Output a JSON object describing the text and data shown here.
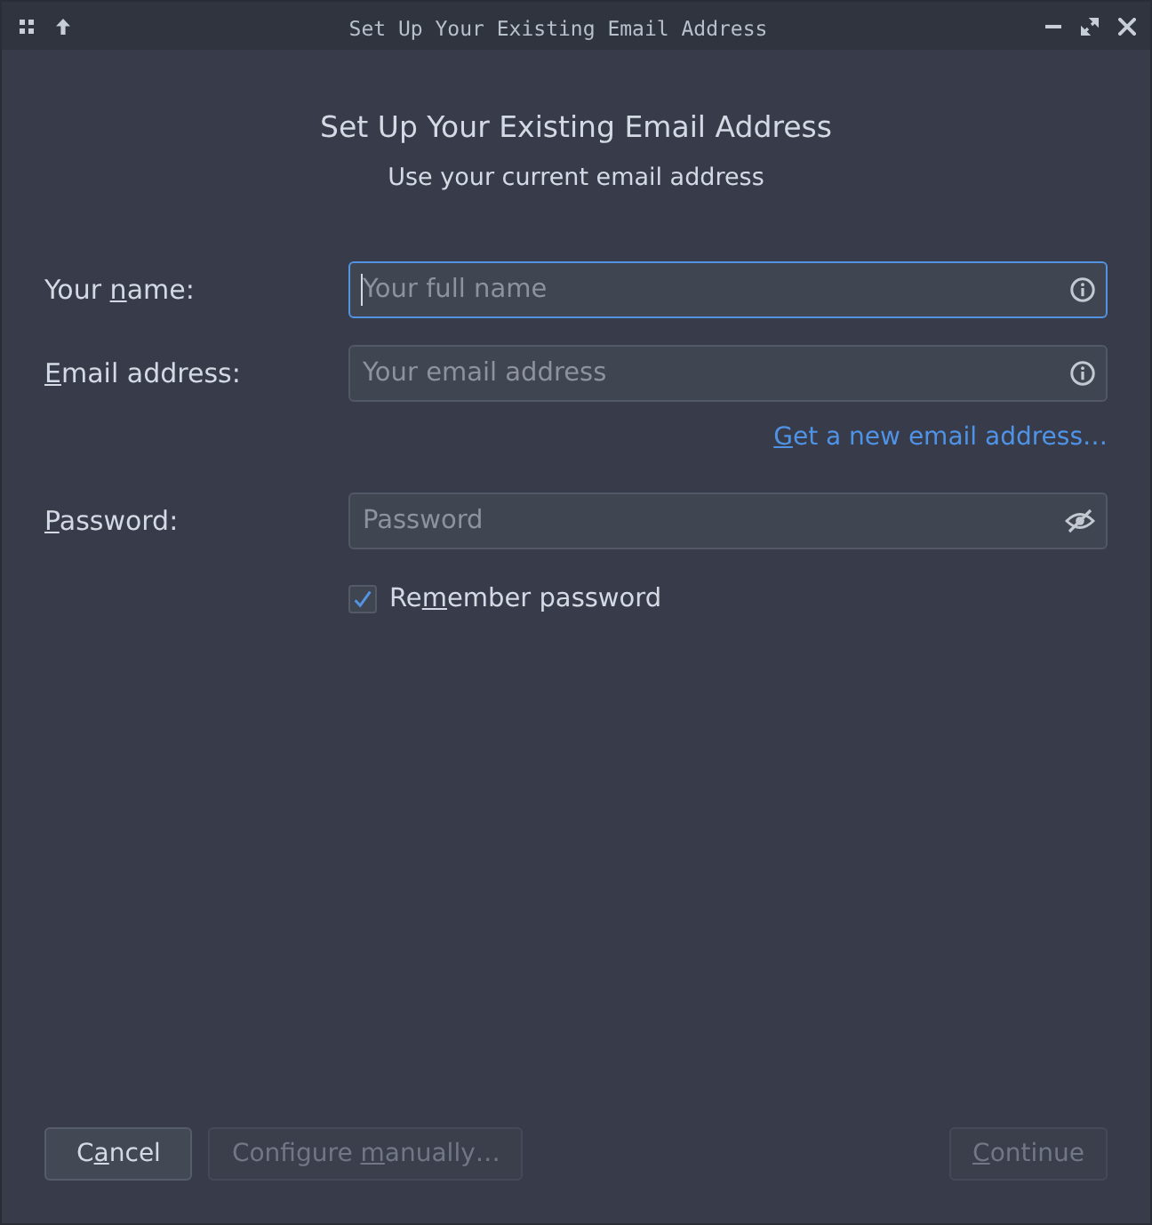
{
  "window": {
    "title": "Set Up Your Existing Email Address"
  },
  "header": {
    "title": "Set Up Your Existing Email Address",
    "subtitle": "Use your current email address"
  },
  "rows": [
    {
      "kind": "text_field",
      "label": {
        "before": "Your ",
        "key": "n",
        "after": "ame:"
      },
      "placeholder": "Your full name",
      "focused": true
    },
    {
      "kind": "text_field",
      "label": {
        "key": "E",
        "after": "mail address:"
      },
      "placeholder": "Your email address",
      "focused": false
    },
    {
      "kind": "link",
      "text": {
        "key": "G",
        "after": "et a new email address…"
      }
    },
    {
      "kind": "password_field",
      "label": {
        "key": "P",
        "after": "assword:"
      },
      "placeholder": "Password",
      "focused": false
    },
    {
      "kind": "checkbox",
      "text": {
        "before": "Re",
        "key": "m",
        "after": "ember password"
      },
      "checked": true
    }
  ],
  "buttons_left": [
    {
      "label": {
        "before": "C",
        "key": "a",
        "after": "ncel"
      },
      "disabled": false
    },
    {
      "label": {
        "before": "Configure ",
        "key": "m",
        "after": "anually…"
      },
      "disabled": true
    }
  ],
  "buttons_right": [
    {
      "label": {
        "key": "C",
        "after": "ontinue"
      },
      "disabled": true
    }
  ]
}
